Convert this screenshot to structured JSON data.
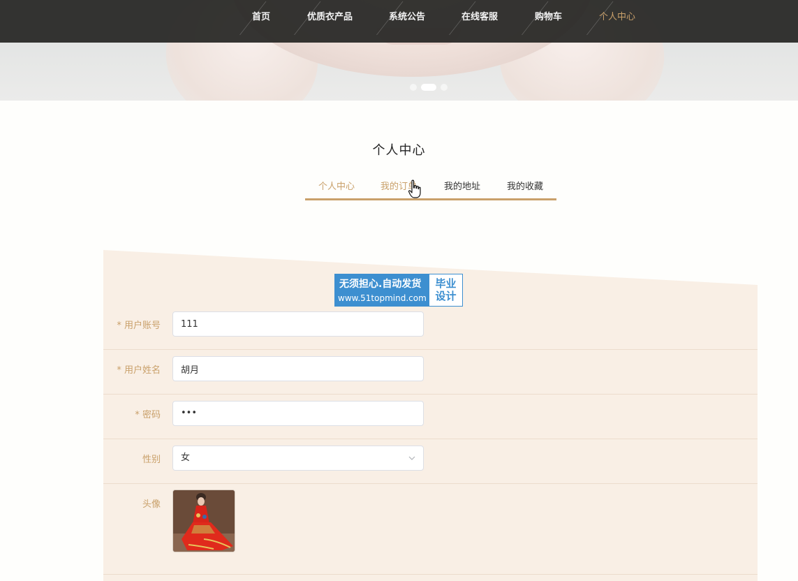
{
  "nav": {
    "items": [
      {
        "label": "首页"
      },
      {
        "label": "优质衣产品"
      },
      {
        "label": "系统公告"
      },
      {
        "label": "在线客服"
      },
      {
        "label": "购物车"
      },
      {
        "label": "个人中心",
        "active": true
      }
    ]
  },
  "carousel": {
    "slide_count": 3,
    "active_index": 1
  },
  "page_title": "个人中心",
  "tabs": [
    {
      "label": "个人中心",
      "active": true
    },
    {
      "label": "我的订单"
    },
    {
      "label": "我的地址"
    },
    {
      "label": "我的收藏"
    }
  ],
  "form": {
    "account": {
      "label": "* 用户账号",
      "value": "111"
    },
    "name": {
      "label": "* 用户姓名",
      "value": "胡月"
    },
    "password": {
      "label": "* 密码",
      "value": "•••"
    },
    "gender": {
      "label": "性别",
      "value": "女"
    },
    "avatar": {
      "label": "头像"
    }
  },
  "watermark": {
    "title": "无须担心.自动发货",
    "url": "www.51topmind.com",
    "badge_line1": "毕业",
    "badge_line2": "设计"
  },
  "colors": {
    "accent": "#c9a06a",
    "nav_bg": "#262624",
    "panel_bg": "#f9efe5",
    "watermark_blue": "#3d8fd0"
  }
}
